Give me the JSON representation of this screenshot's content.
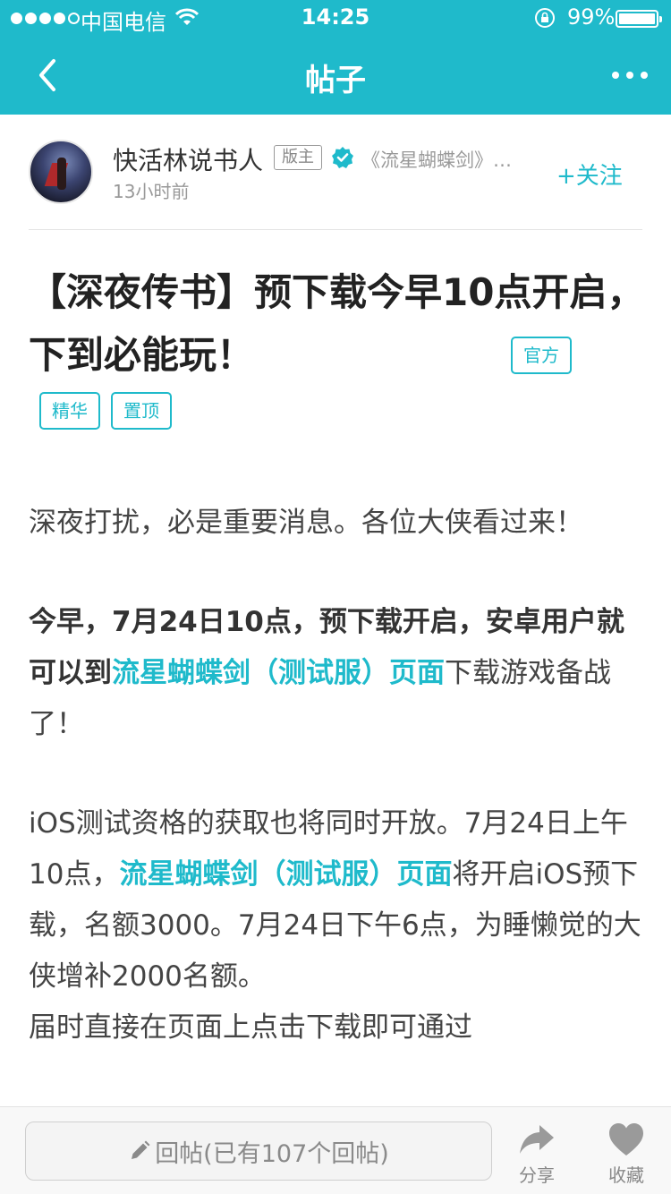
{
  "status_bar": {
    "carrier": "中国电信",
    "time": "14:25",
    "battery": "99%"
  },
  "nav": {
    "title": "帖子"
  },
  "author": {
    "name": "快活林说书人",
    "badge": "版主",
    "game": "《流星蝴蝶剑》…",
    "time": "13小时前",
    "follow_label": "+关注"
  },
  "post": {
    "title": "【深夜传书】预下载今早10点开启，下到必能玩！",
    "tags": {
      "official": "官方",
      "featured": "精华",
      "pinned": "置顶"
    },
    "body": {
      "p1": "深夜打扰，必是重要消息。各位大侠看过来！",
      "p2_bold": "今早，7月24日10点",
      "p2_mid": "，预下载开启，安卓用户就可以到",
      "p2_link": "流星蝴蝶剑（测试服）页面",
      "p2_end": "下载游戏备战了！",
      "p3_a": "iOS测试资格的获取也将同时开放。7月24日上午10点，",
      "p3_link": "流星蝴蝶剑（测试服）页面",
      "p3_b": "将开启iOS预下载，名额3000。7月24日下午6点，为睡懒觉的大侠增补2000名额。",
      "p4": "届时直接在页面上点击下载即可通过"
    }
  },
  "bottom_bar": {
    "reply_placeholder": "回帖(已有107个回帖)",
    "share_label": "分享",
    "favorite_label": "收藏"
  },
  "colors": {
    "accent": "#1fbacb",
    "text": "#333333",
    "muted": "#999999"
  },
  "icons": [
    "signal-icon",
    "wifi-icon",
    "rotation-lock-icon",
    "battery-icon",
    "back-icon",
    "more-icon",
    "verified-icon",
    "pencil-icon",
    "share-icon",
    "heart-icon"
  ]
}
